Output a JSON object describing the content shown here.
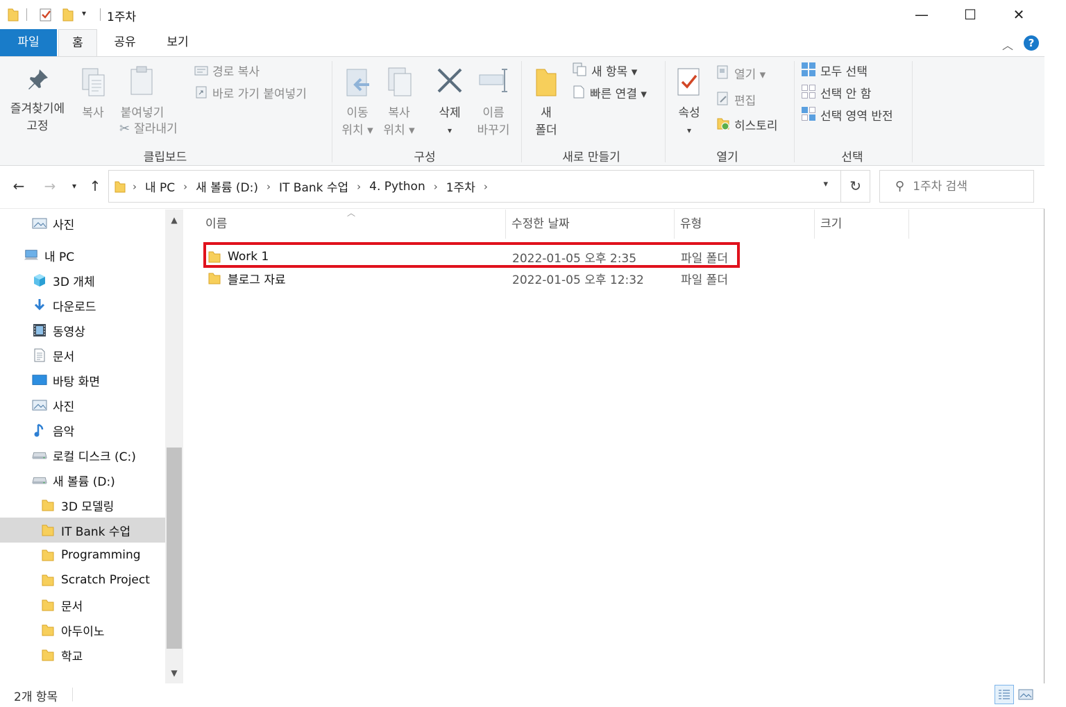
{
  "window": {
    "title": "1주차",
    "minimize_glyph": "—",
    "maximize_glyph": "☐",
    "close_glyph": "✕"
  },
  "tabs": {
    "file": "파일",
    "home": "홈",
    "share": "공유",
    "view": "보기"
  },
  "ribbon": {
    "clipboard": {
      "pin_line1": "즐겨찾기에",
      "pin_line2": "고정",
      "copy": "복사",
      "paste": "붙여넣기",
      "copy_path": "경로 복사",
      "paste_shortcut": "바로 가기 붙여넣기",
      "cut": "잘라내기",
      "label": "클립보드"
    },
    "organize": {
      "move_line1": "이동",
      "move_line2": "위치 ▾",
      "copyto_line1": "복사",
      "copyto_line2": "위치 ▾",
      "delete": "삭제",
      "delete_arrow": "▾",
      "rename_line1": "이름",
      "rename_line2": "바꾸기",
      "label": "구성"
    },
    "new": {
      "folder_line1": "새",
      "folder_line2": "폴더",
      "new_item": "새 항목 ▾",
      "easy_access": "빠른 연결 ▾",
      "label": "새로 만들기"
    },
    "open": {
      "properties": "속성",
      "properties_arrow": "▾",
      "open": "열기 ▾",
      "edit": "편집",
      "history": "히스토리",
      "label": "열기"
    },
    "select": {
      "select_all": "모두 선택",
      "select_none": "선택 안 함",
      "invert": "선택 영역 반전",
      "label": "선택"
    }
  },
  "address": {
    "crumbs": [
      "내 PC",
      "새 볼륨 (D:)",
      "IT Bank 수업",
      "4. Python",
      "1주차"
    ],
    "search_placeholder": "1주차 검색"
  },
  "nav": {
    "items": [
      {
        "label": "사진",
        "icon": "pictures-icon"
      },
      {
        "label": "내 PC",
        "icon": "pc-icon"
      },
      {
        "label": "3D 개체",
        "icon": "3d-objects-icon"
      },
      {
        "label": "다운로드",
        "icon": "download-icon"
      },
      {
        "label": "동영상",
        "icon": "video-icon"
      },
      {
        "label": "문서",
        "icon": "document-icon"
      },
      {
        "label": "바탕 화면",
        "icon": "desktop-icon"
      },
      {
        "label": "사진",
        "icon": "pictures-icon"
      },
      {
        "label": "음악",
        "icon": "music-icon"
      },
      {
        "label": "로컬 디스크 (C:)",
        "icon": "drive-icon"
      },
      {
        "label": "새 볼륨 (D:)",
        "icon": "drive-icon"
      },
      {
        "label": "3D 모델링",
        "icon": "folder-icon"
      },
      {
        "label": "IT Bank 수업",
        "icon": "folder-icon"
      },
      {
        "label": "Programming",
        "icon": "folder-icon"
      },
      {
        "label": "Scratch Project",
        "icon": "folder-icon"
      },
      {
        "label": "문서",
        "icon": "folder-icon"
      },
      {
        "label": "아두이노",
        "icon": "folder-icon"
      },
      {
        "label": "학교",
        "icon": "folder-icon"
      }
    ],
    "selected_index": 12
  },
  "filelist": {
    "columns": [
      "이름",
      "수정한 날짜",
      "유형",
      "크기"
    ],
    "rows": [
      {
        "name": "Work 1",
        "modified": "2022-01-05 오후 2:35",
        "type": "파일 폴더"
      },
      {
        "name": "블로그 자료",
        "modified": "2022-01-05 오후 12:32",
        "type": "파일 폴더"
      }
    ]
  },
  "status": {
    "item_count": "2개 항목"
  },
  "colors": {
    "file_tab": "#197cc9",
    "highlight": "#e0121d",
    "folder": "#f7cf5b"
  }
}
